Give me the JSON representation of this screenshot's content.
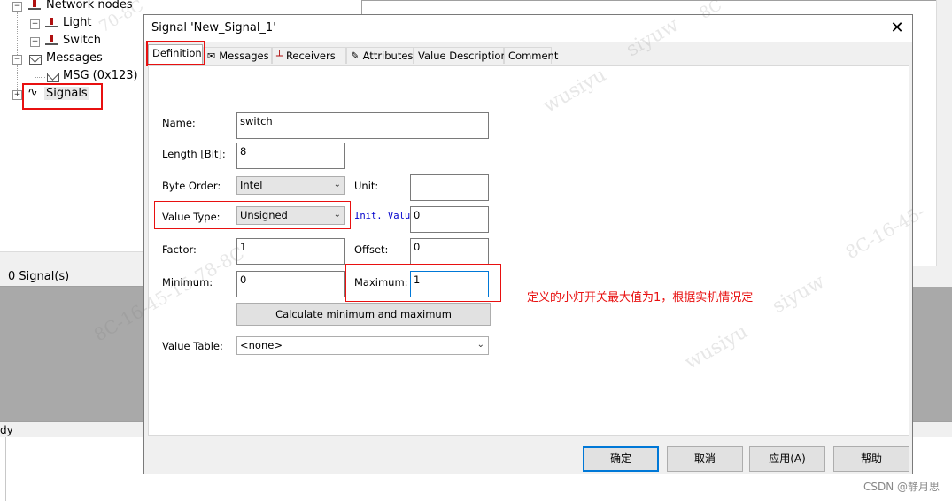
{
  "tree": {
    "network_nodes": "Network nodes",
    "light": "Light",
    "switch": "Switch",
    "messages": "Messages",
    "msg": "MSG (0x123)",
    "signals": "Signals",
    "expander_collapse": "−",
    "expander_expand": "+"
  },
  "status": {
    "signal_count": "0 Signal(s)",
    "ready_fragment": "dy"
  },
  "dialog": {
    "title": "Signal 'New_Signal_1'",
    "close_glyph": "✕",
    "tabs": [
      {
        "label": "Definition",
        "icon": ""
      },
      {
        "label": "Messages",
        "icon": "envelope-icon"
      },
      {
        "label": "Receivers",
        "icon": "node-icon"
      },
      {
        "label": "Attributes",
        "icon": "pencil-icon"
      },
      {
        "label": "Value Descriptions",
        "icon": ""
      },
      {
        "label": "Comment",
        "icon": ""
      }
    ],
    "form": {
      "name_label": "Name:",
      "name_value": "switch",
      "length_label": "Length [Bit]:",
      "length_value": "8",
      "byte_order_label": "Byte Order:",
      "byte_order_value": "Intel",
      "unit_label": "Unit:",
      "unit_value": "",
      "value_type_label": "Value Type:",
      "value_type_value": "Unsigned",
      "init_value_link": "Init. Value",
      "init_value": "0",
      "factor_label": "Factor:",
      "factor_value": "1",
      "offset_label": "Offset:",
      "offset_value": "0",
      "minimum_label": "Minimum:",
      "minimum_value": "0",
      "maximum_label": "Maximum:",
      "maximum_value": "1",
      "calc_button": "Calculate minimum and maximum",
      "value_table_label": "Value Table:",
      "value_table_value": "<none>"
    },
    "buttons": {
      "ok": "确定",
      "cancel": "取消",
      "apply": "应用(A)",
      "help": "帮助"
    }
  },
  "annotation": {
    "text": "定义的小灯开关最大值为1，根据实机情况定",
    "color": "#e81010"
  },
  "watermark": {
    "user": "wusiyu",
    "user2": "siyuw",
    "id_fragment_a": "8C-16-45-15-78-8C",
    "id_fragment_b": "70-8C",
    "id_fragment_c": "8C-16-45",
    "id_fragment_d": "8C-16-45-",
    "id_fragment_e": "8C",
    "id_fragment_f": "8C-16-45-15-78-8C"
  },
  "credit": "CSDN @静月思"
}
